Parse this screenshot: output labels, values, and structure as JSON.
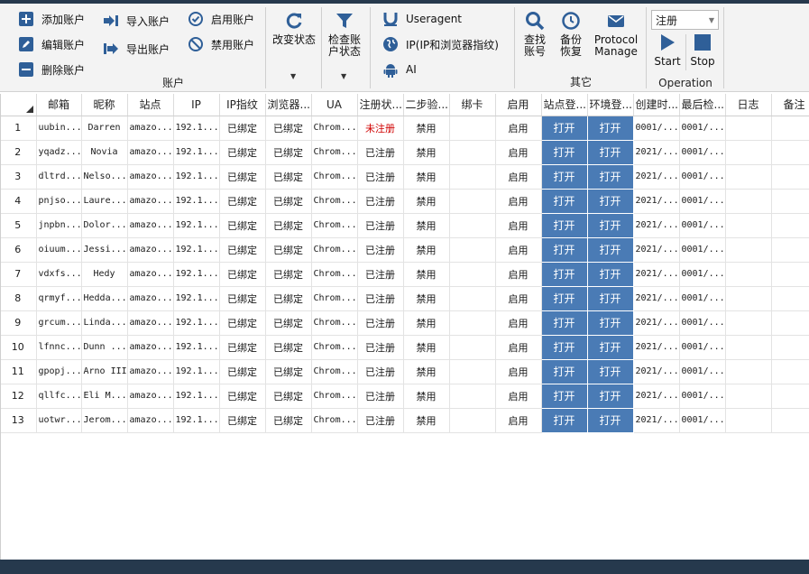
{
  "ribbon": {
    "account_group": {
      "label": "账户",
      "buttons": {
        "add": "添加账户",
        "edit": "编辑账户",
        "delete": "删除账户",
        "import": "导入账户",
        "export": "导出账户",
        "enable": "启用账户",
        "disable": "禁用账户",
        "change_status": "改变状态",
        "check_status": "检查账户状态"
      }
    },
    "settings_group": {
      "useragent": "Useragent",
      "ip": "IP(IP和浏览器指纹)",
      "ai": "AI"
    },
    "other_group": {
      "label": "其它",
      "find": "查找账号",
      "backup": "备份恢复",
      "protocol": "Protocol Manage"
    },
    "operation_group": {
      "label": "Operation",
      "select_value": "注册",
      "start": "Start",
      "stop": "Stop"
    }
  },
  "grid": {
    "columns": [
      "",
      "邮箱",
      "昵称",
      "站点",
      "IP",
      "IP指纹",
      "浏览器...",
      "UA",
      "注册状...",
      "二步验...",
      "绑卡",
      "启用",
      "站点登...",
      "环境登...",
      "创建时...",
      "最后检...",
      "日志",
      "备注"
    ],
    "rows": [
      [
        "1",
        "uubin...",
        "Darren",
        "amazo...",
        "192.1...",
        "已绑定",
        "已绑定",
        "Chrom...",
        "未注册",
        "禁用",
        "",
        "启用",
        "打开",
        "打开",
        "0001/...",
        "0001/...",
        "",
        ""
      ],
      [
        "2",
        "yqadz...",
        "Novia",
        "amazo...",
        "192.1...",
        "已绑定",
        "已绑定",
        "Chrom...",
        "已注册",
        "禁用",
        "",
        "启用",
        "打开",
        "打开",
        "2021/...",
        "0001/...",
        "",
        ""
      ],
      [
        "3",
        "dltrd...",
        "Nelso...",
        "amazo...",
        "192.1...",
        "已绑定",
        "已绑定",
        "Chrom...",
        "已注册",
        "禁用",
        "",
        "启用",
        "打开",
        "打开",
        "2021/...",
        "0001/...",
        "",
        ""
      ],
      [
        "4",
        "pnjso...",
        "Laure...",
        "amazo...",
        "192.1...",
        "已绑定",
        "已绑定",
        "Chrom...",
        "已注册",
        "禁用",
        "",
        "启用",
        "打开",
        "打开",
        "2021/...",
        "0001/...",
        "",
        ""
      ],
      [
        "5",
        "jnpbn...",
        "Dolor...",
        "amazo...",
        "192.1...",
        "已绑定",
        "已绑定",
        "Chrom...",
        "已注册",
        "禁用",
        "",
        "启用",
        "打开",
        "打开",
        "2021/...",
        "0001/...",
        "",
        ""
      ],
      [
        "6",
        "oiuum...",
        "Jessi...",
        "amazo...",
        "192.1...",
        "已绑定",
        "已绑定",
        "Chrom...",
        "已注册",
        "禁用",
        "",
        "启用",
        "打开",
        "打开",
        "2021/...",
        "0001/...",
        "",
        ""
      ],
      [
        "7",
        "vdxfs...",
        "Hedy",
        "amazo...",
        "192.1...",
        "已绑定",
        "已绑定",
        "Chrom...",
        "已注册",
        "禁用",
        "",
        "启用",
        "打开",
        "打开",
        "2021/...",
        "0001/...",
        "",
        ""
      ],
      [
        "8",
        "qrmyf...",
        "Hedda...",
        "amazo...",
        "192.1...",
        "已绑定",
        "已绑定",
        "Chrom...",
        "已注册",
        "禁用",
        "",
        "启用",
        "打开",
        "打开",
        "2021/...",
        "0001/...",
        "",
        ""
      ],
      [
        "9",
        "grcum...",
        "Linda...",
        "amazo...",
        "192.1...",
        "已绑定",
        "已绑定",
        "Chrom...",
        "已注册",
        "禁用",
        "",
        "启用",
        "打开",
        "打开",
        "2021/...",
        "0001/...",
        "",
        ""
      ],
      [
        "10",
        "lfnnc...",
        "Dunn ...",
        "amazo...",
        "192.1...",
        "已绑定",
        "已绑定",
        "Chrom...",
        "已注册",
        "禁用",
        "",
        "启用",
        "打开",
        "打开",
        "2021/...",
        "0001/...",
        "",
        ""
      ],
      [
        "11",
        "gpopj...",
        "Arno III",
        "amazo...",
        "192.1...",
        "已绑定",
        "已绑定",
        "Chrom...",
        "已注册",
        "禁用",
        "",
        "启用",
        "打开",
        "打开",
        "2021/...",
        "0001/...",
        "",
        ""
      ],
      [
        "12",
        "qllfc...",
        "Eli M...",
        "amazo...",
        "192.1...",
        "已绑定",
        "已绑定",
        "Chrom...",
        "已注册",
        "禁用",
        "",
        "启用",
        "打开",
        "打开",
        "2021/...",
        "0001/...",
        "",
        ""
      ],
      [
        "13",
        "uotwr...",
        "Jerom...",
        "amazo...",
        "192.1...",
        "已绑定",
        "已绑定",
        "Chrom...",
        "已注册",
        "禁用",
        "",
        "启用",
        "打开",
        "打开",
        "2021/...",
        "0001/...",
        "",
        ""
      ]
    ]
  },
  "colors": {
    "title_bar": "#26394d",
    "icon_blue": "#2f5f98",
    "open_cell": "#4a7bb5",
    "unregistered": "#d00000"
  }
}
